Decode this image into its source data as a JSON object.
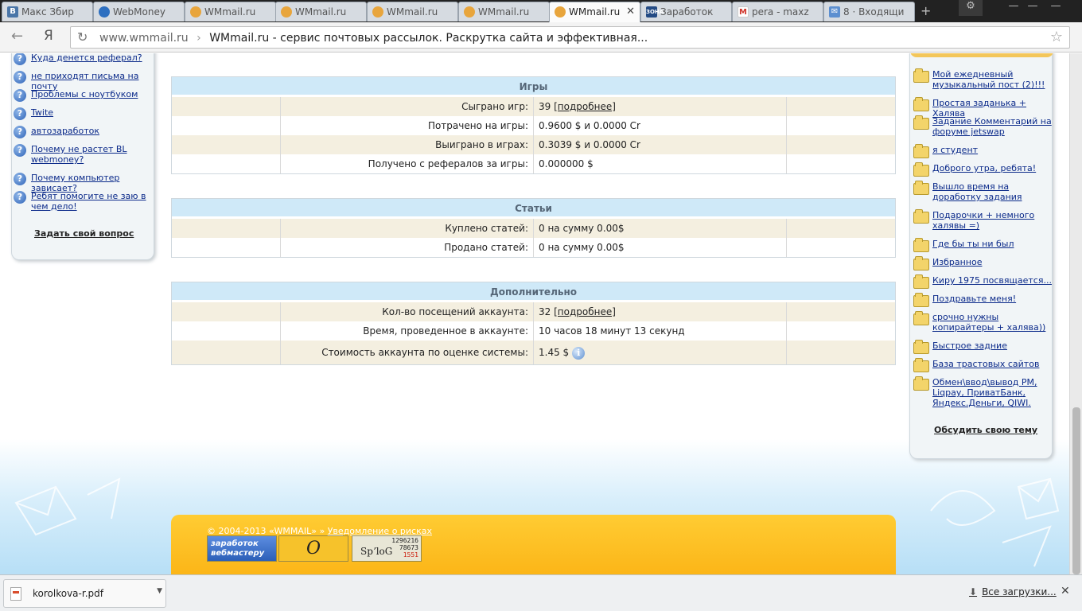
{
  "browser": {
    "tabs": [
      {
        "title": "Макс Збир",
        "favicon": "vk-icon",
        "fav_char": "В"
      },
      {
        "title": "WebMoney",
        "favicon": "webmoney-icon",
        "fav_char": ""
      },
      {
        "title": "WMmail.ru",
        "favicon": "wmmail-icon",
        "fav_char": ""
      },
      {
        "title": "WMmail.ru",
        "favicon": "wmmail-icon",
        "fav_char": ""
      },
      {
        "title": "WMmail.ru",
        "favicon": "wmmail-icon",
        "fav_char": ""
      },
      {
        "title": "WMmail.ru",
        "favicon": "wmmail-icon",
        "fav_char": ""
      },
      {
        "title": "WMmail.ru",
        "favicon": "wmmail-icon",
        "fav_char": "",
        "active": true
      },
      {
        "title": "Заработок",
        "favicon": "zona-icon",
        "fav_char": "ЗОНА"
      },
      {
        "title": "pera - maxz",
        "favicon": "gmail-icon",
        "fav_char": "M"
      },
      {
        "title": "8 · Входящи",
        "favicon": "mail-icon",
        "fav_char": "✉"
      }
    ],
    "new_tab_glyph": "+",
    "tab_close_glyph": "✕",
    "window_controls": [
      "⚙",
      "—",
      "—",
      "—"
    ],
    "nav": {
      "back_glyph": "←",
      "yandex_glyph": "Я",
      "reload_glyph": "↻",
      "star_glyph": "☆"
    },
    "address": {
      "domain": "www.wmmail.ru",
      "separator": "›",
      "title": "WMmail.ru - сервис почтовых рассылок. Раскрутка сайта и эффективная..."
    }
  },
  "left_sidebar": {
    "questions": [
      {
        "icon": "question-icon",
        "text": "Куда денется реферал?"
      },
      {
        "icon": "question-icon",
        "text": "не приходят письма на почту"
      },
      {
        "icon": "question-icon",
        "text": "Проблемы с ноутбуком"
      },
      {
        "icon": "question-icon",
        "text": "Twite"
      },
      {
        "icon": "question-icon",
        "text": "автозаработок"
      },
      {
        "icon": "question-icon",
        "text": "Почему не растет BL webmoney?"
      },
      {
        "icon": "question-icon",
        "text": "Почему компьютер зависает?"
      },
      {
        "icon": "question-icon",
        "text": "Ребят помогите не заю в чем дело!"
      }
    ],
    "question_glyph": "?",
    "ask_label": "Задать свой вопрос"
  },
  "right_sidebar": {
    "topics": [
      {
        "icon": "folder-icon",
        "text": "Мой ежедневный музыкальный пост (2)!!!"
      },
      {
        "icon": "folder-icon",
        "text": "Простая заданька + Халява"
      },
      {
        "icon": "folder-icon",
        "text": "Задание Комментарий на форуме jetswap"
      },
      {
        "icon": "folder-icon",
        "text": "я студент"
      },
      {
        "icon": "folder-icon",
        "text": "Доброго утра, ребята!"
      },
      {
        "icon": "folder-icon",
        "text": "Вышло время на доработку задания"
      },
      {
        "icon": "folder-icon",
        "text": "Подарочки + немного халявы =)"
      },
      {
        "icon": "folder-icon",
        "text": "Где бы ты ни был"
      },
      {
        "icon": "folder-icon",
        "text": "Избранное"
      },
      {
        "icon": "folder-icon",
        "text": "Киру 1975 посвящается..."
      },
      {
        "icon": "folder-icon",
        "text": "Поздравьте меня!"
      },
      {
        "icon": "folder-icon",
        "text": "срочно нужны копирайтеры + халява))"
      },
      {
        "icon": "folder-icon",
        "text": "Быстрое задние"
      },
      {
        "icon": "folder-icon",
        "text": "База трастовых сайтов"
      },
      {
        "icon": "folder-icon",
        "text": "Обмен\\ввод\\вывод PM, Liqpay, ПриватБанк, Яндекс.Деньги, QIWI."
      }
    ],
    "discuss_label": "Обсудить свою тему"
  },
  "stats": {
    "games": {
      "title": "Игры",
      "rows": [
        {
          "label": "Сыграно игр:",
          "value": "39",
          "link": "[подробнее]"
        },
        {
          "label": "Потрачено на игры:",
          "value": "0.9600 $ и 0.0000 Cr"
        },
        {
          "label": "Выиграно в играх:",
          "value": "0.3039 $ и 0.0000 Cr"
        },
        {
          "label": "Получено с рефералов за игры:",
          "value": "0.000000 $"
        }
      ]
    },
    "articles": {
      "title": "Статьи",
      "rows": [
        {
          "label": "Куплено статей:",
          "value": "0 на сумму 0.00$"
        },
        {
          "label": "Продано статей:",
          "value": "0 на сумму 0.00$"
        }
      ]
    },
    "extra": {
      "title": "Дополнительно",
      "rows": [
        {
          "label": "Кол-во посещений аккаунта:",
          "value": "32",
          "link": "[подробнее]"
        },
        {
          "label": "Время, проведенное в аккаунте:",
          "value": "10 часов 18 минут 13 секунд"
        },
        {
          "label": "Стоимость аккаунта по оценке системы:",
          "value": "1.45 $",
          "info_glyph": "i"
        }
      ]
    }
  },
  "footer": {
    "copyright": "© 2004-2013 «WMMAIL» »",
    "risk_link": "Уведомление о рисках",
    "badge_earn": "заработок вебмастеру",
    "badge_o": "O",
    "badge_spy_logo": "SpʼloG",
    "badge_spy_nums": [
      "1296216",
      "78673",
      "1551"
    ]
  },
  "download_shelf": {
    "file_name": "korolkova-r.pdf",
    "dropdown_glyph": "▼",
    "all_downloads_label": "Все загрузки...",
    "all_downloads_glyph": "⬇",
    "close_glyph": "✕"
  },
  "colors": {
    "table_header_bg": "#cfe9f8",
    "row_alt_bg": "#f4efe0",
    "footer_orange": "#fbb416",
    "link_blue": "#0b2a8a"
  }
}
